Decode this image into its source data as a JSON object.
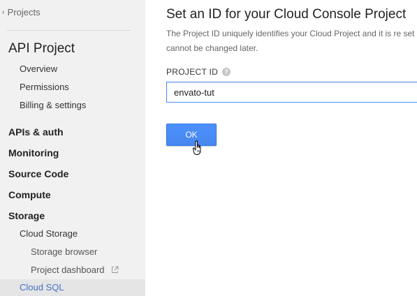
{
  "sidebar": {
    "back_link": {
      "label": "Projects",
      "icon": "chevron-left-icon"
    },
    "project_title": "API Project",
    "items": [
      {
        "label": "Overview",
        "level": 2
      },
      {
        "label": "Permissions",
        "level": 2
      },
      {
        "label": "Billing & settings",
        "level": 2
      },
      {
        "label": "APIs & auth",
        "level": 1
      },
      {
        "label": "Monitoring",
        "level": 1
      },
      {
        "label": "Source Code",
        "level": 1
      },
      {
        "label": "Compute",
        "level": 1
      },
      {
        "label": "Storage",
        "level": 1
      },
      {
        "label": "Cloud Storage",
        "level": 2
      },
      {
        "label": "Storage browser",
        "level": 3
      },
      {
        "label": "Project dashboard",
        "level": 3,
        "icon": "external-link-icon"
      },
      {
        "label": "Cloud SQL",
        "level": 2,
        "active": true
      }
    ]
  },
  "main": {
    "title": "Set an ID for your Cloud Console Project",
    "description": "The Project ID uniquely identifies your Cloud Project and it is re set once and cannot be changed later.",
    "field_label": "PROJECT ID",
    "help_icon": "question-mark-icon",
    "project_id_value": "envato-tut",
    "ok_label": "OK"
  },
  "colors": {
    "sidebar_bg": "#f1f1f1",
    "accent": "#4d90fe",
    "active_link": "#4272c8"
  }
}
